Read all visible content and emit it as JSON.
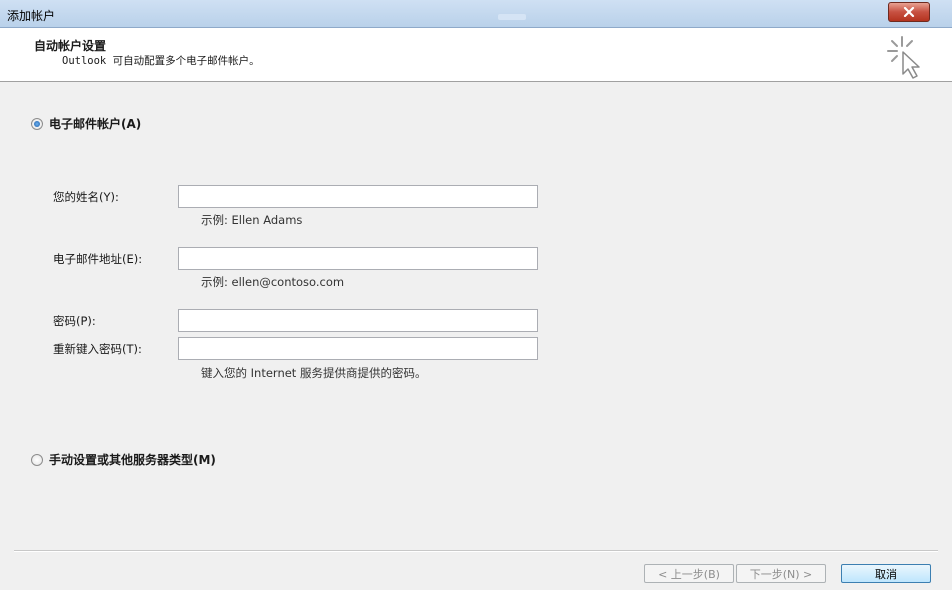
{
  "window": {
    "title": "添加帐户",
    "close_icon": "close-icon"
  },
  "header": {
    "title": "自动帐户设置",
    "subtitle": "Outlook 可自动配置多个电子邮件帐户。",
    "icon": "wizard-cursor-icon"
  },
  "options": {
    "email_account_label": "电子邮件帐户(A)",
    "manual_setup_label": "手动设置或其他服务器类型(M)",
    "selected": "email_account"
  },
  "form": {
    "name_label": "您的姓名(Y):",
    "name_value": "",
    "name_hint": "示例: Ellen Adams",
    "email_label": "电子邮件地址(E):",
    "email_value": "",
    "email_hint": "示例: ellen@contoso.com",
    "password_label": "密码(P):",
    "password_value": "",
    "retype_label": "重新键入密码(T):",
    "retype_value": "",
    "password_hint": "键入您的 Internet 服务提供商提供的密码。"
  },
  "footer": {
    "back_label": "< 上一步(B)",
    "next_label": "下一步(N) >",
    "cancel_label": "取消"
  },
  "colors": {
    "titlebar": "#c3d8ef",
    "close_button": "#c75142",
    "radio_selected": "#1f5ea8",
    "background": "#f0f0f0"
  }
}
